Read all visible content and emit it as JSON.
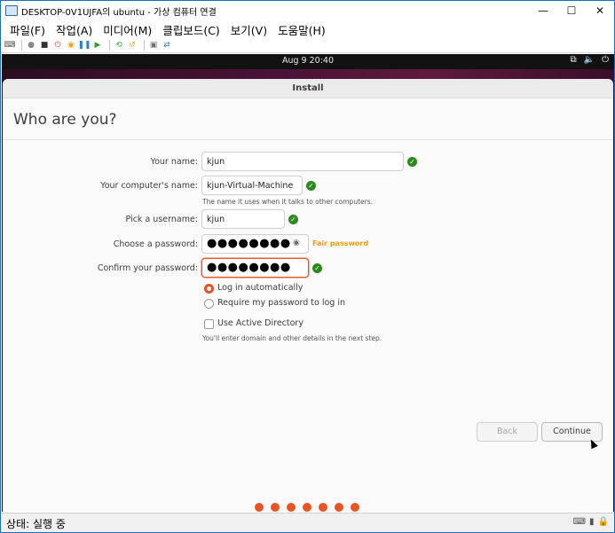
{
  "window": {
    "title": "DESKTOP-0V1UJFA의 ubuntu - 가상 컴퓨터 연결",
    "controls": {
      "minimize": "—",
      "maximize": "☐",
      "close": "✕"
    }
  },
  "menu": [
    "파일(F)",
    "작업(A)",
    "미디어(M)",
    "클립보드(C)",
    "보기(V)",
    "도움말(H)"
  ],
  "toolbar": {
    "icons": [
      "ctrl-alt-del-icon",
      "start-icon",
      "turn-off-icon",
      "shutdown-icon",
      "save-icon",
      "pause-icon",
      "resume-icon",
      "checkpoint-icon",
      "revert-icon",
      "enhanced-session-icon",
      "share-icon"
    ],
    "glyphs": [
      "⌨",
      "●",
      "■",
      "⏻",
      "◉",
      "❚❚",
      "▶",
      "⟲",
      "↺",
      "▣",
      "⇄"
    ],
    "colors": [
      "#555555",
      "#888888",
      "#333333",
      "#d63b2e",
      "#e8a418",
      "#2a7fd4",
      "#2f9e3a",
      "#2f9e3a",
      "#e8a418",
      "#6f6f6f",
      "#2a7fd4"
    ]
  },
  "ubuntu_topbar": {
    "clock": "Aug 9  20:40",
    "tray": {
      "network": "⧉",
      "volume": "🔈",
      "power": "⏻"
    }
  },
  "installer": {
    "window_title": "Install",
    "heading": "Who are you?",
    "name_label": "Your name:",
    "name_value": "kjun",
    "computer_label": "Your computer's name:",
    "computer_value": "kjun-Virtual-Machine",
    "computer_hint": "The name it uses when it talks to other computers.",
    "username_label": "Pick a username:",
    "username_value": "kjun",
    "password_label": "Choose a password:",
    "password_value": "●●●●●●●●",
    "password_strength": "Fair password",
    "confirm_label": "Confirm your password:",
    "confirm_value": "●●●●●●●●",
    "login_auto": "Log in automatically",
    "login_require": "Require my password to log in",
    "active_directory": "Use Active Directory",
    "ad_hint": "You'll enter domain and other details in the next step.",
    "back_button": "Back",
    "continue_button": "Continue",
    "progress_steps": 7,
    "accent_color": "#e95420",
    "check_glyph": "✓"
  },
  "status": {
    "text": "상태: 실행 중"
  }
}
